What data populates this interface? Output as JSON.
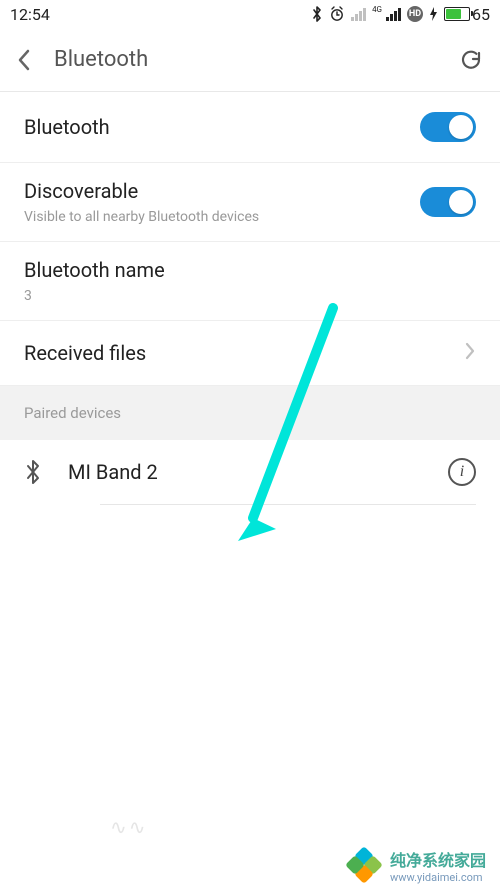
{
  "status": {
    "time": "12:54",
    "battery_pct": "65"
  },
  "appbar": {
    "title": "Bluetooth"
  },
  "rows": {
    "bluetooth": {
      "title": "Bluetooth"
    },
    "discoverable": {
      "title": "Discoverable",
      "sub": "Visible to all nearby Bluetooth devices"
    },
    "name": {
      "title": "Bluetooth name",
      "value": "3"
    },
    "received": {
      "title": "Received files"
    }
  },
  "sections": {
    "paired": "Paired devices"
  },
  "devices": [
    {
      "name": "MI Band 2"
    }
  ],
  "watermark": {
    "title": "纯净系统家园",
    "url": "www.yidaimei.com"
  }
}
